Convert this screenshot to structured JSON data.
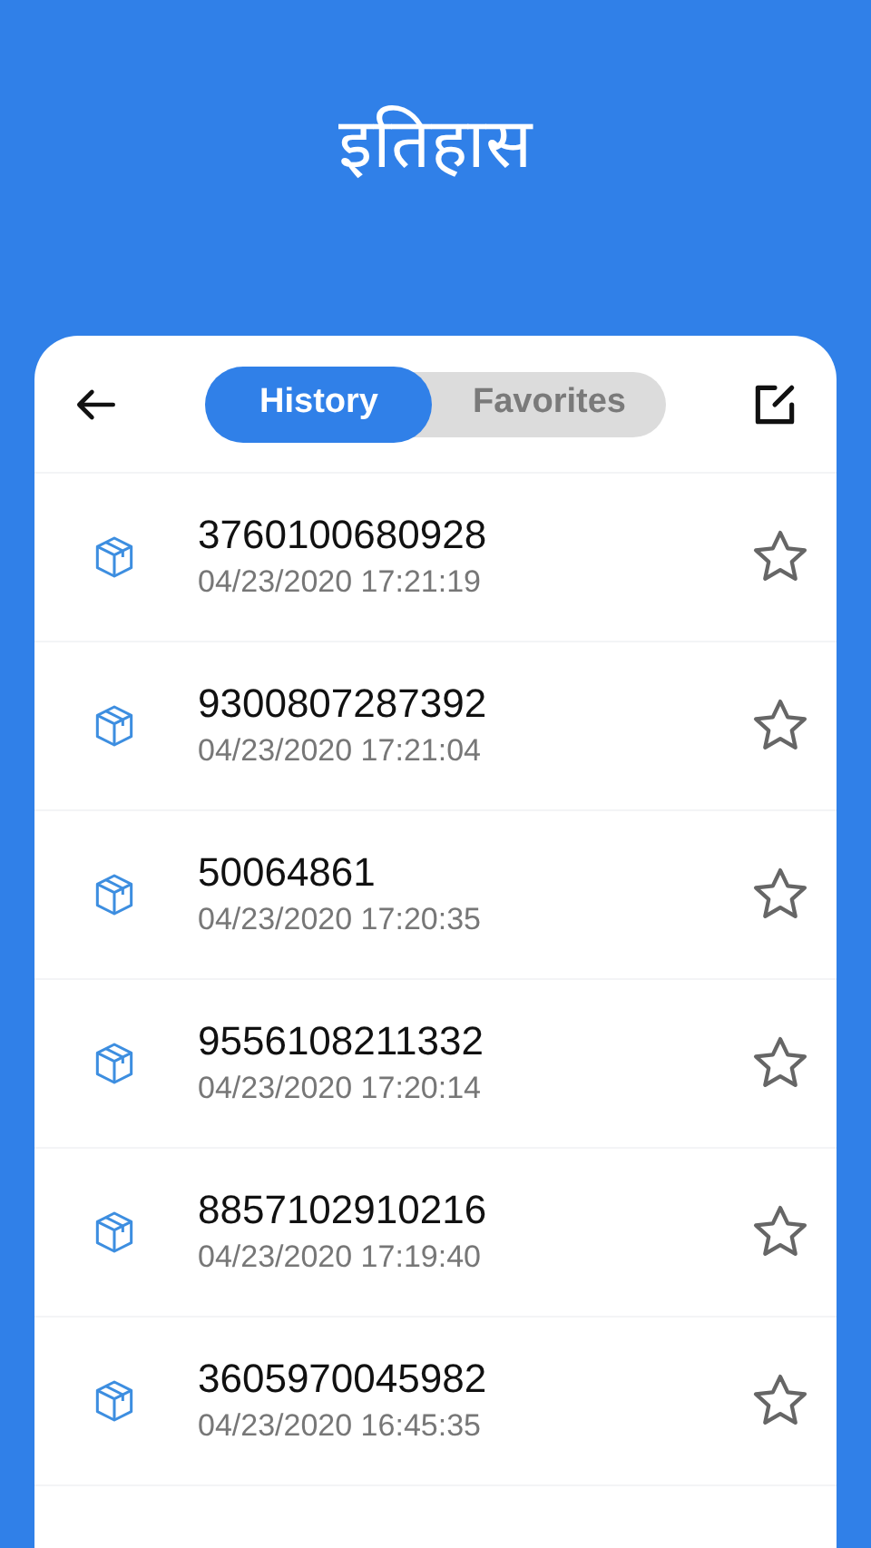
{
  "title": "इतिहास",
  "tabs": [
    {
      "label": "History",
      "selected": true
    },
    {
      "label": "Favorites",
      "selected": false
    }
  ],
  "items": [
    {
      "code": "3760100680928",
      "time": "04/23/2020 17:21:19",
      "favorite": false
    },
    {
      "code": "9300807287392",
      "time": "04/23/2020 17:21:04",
      "favorite": false
    },
    {
      "code": "50064861",
      "time": "04/23/2020 17:20:35",
      "favorite": false
    },
    {
      "code": "9556108211332",
      "time": "04/23/2020 17:20:14",
      "favorite": false
    },
    {
      "code": "8857102910216",
      "time": "04/23/2020 17:19:40",
      "favorite": false
    },
    {
      "code": "3605970045982",
      "time": "04/23/2020 16:45:35",
      "favorite": false
    }
  ]
}
